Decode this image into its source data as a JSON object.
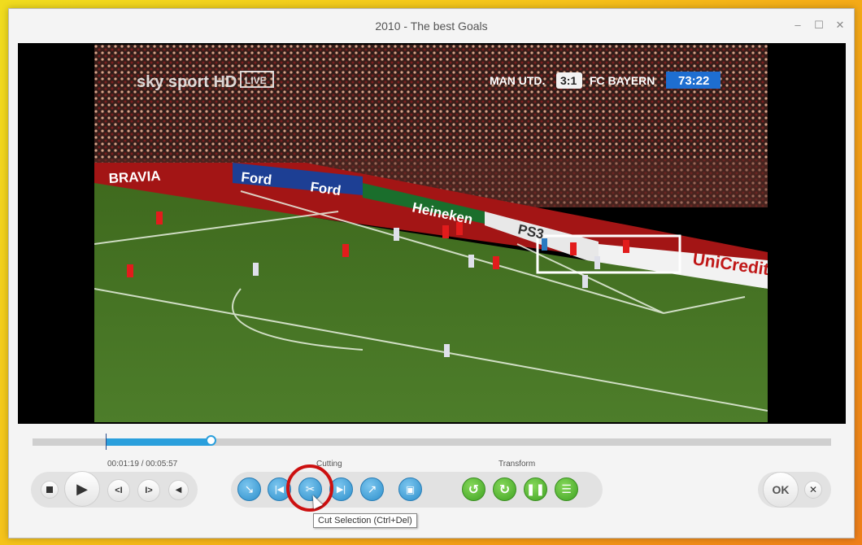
{
  "window": {
    "title": "2010 - The best Goals",
    "minimize": "–",
    "maximize": "☐",
    "close": "✕"
  },
  "video": {
    "broadcaster": "sky sport HD",
    "live_badge": "LIVE",
    "home_team": "MAN UTD.",
    "score": "3:1",
    "away_team": "FC BAYERN",
    "match_clock": "73:22",
    "ad_boards": [
      "BRAVIA",
      "Ford",
      "Ford",
      "Heineken",
      "PS3",
      "UniCredit"
    ]
  },
  "playback": {
    "time": "00:01:19 / 00:05:57",
    "position_fraction": 0.221,
    "selection_start_fraction": 0.092,
    "buttons": {
      "stop": "stop",
      "play": "play",
      "prev_frame": "<I",
      "next_frame": "I>",
      "volume": "volume"
    }
  },
  "cutting": {
    "label": "Cutting",
    "buttons": [
      "set-start",
      "go-start",
      "cut-selection",
      "go-end",
      "set-end",
      "preview"
    ]
  },
  "transform": {
    "label": "Transform",
    "buttons": [
      "rotate-left",
      "rotate-right",
      "flip-horizontal",
      "flip-vertical"
    ]
  },
  "actions": {
    "ok": "OK",
    "cancel": "✕"
  },
  "tooltip": "Cut Selection (Ctrl+Del)",
  "colors": {
    "accent": "#2a9fdc",
    "green": "#4caf2c",
    "highlight": "#cc1010"
  }
}
